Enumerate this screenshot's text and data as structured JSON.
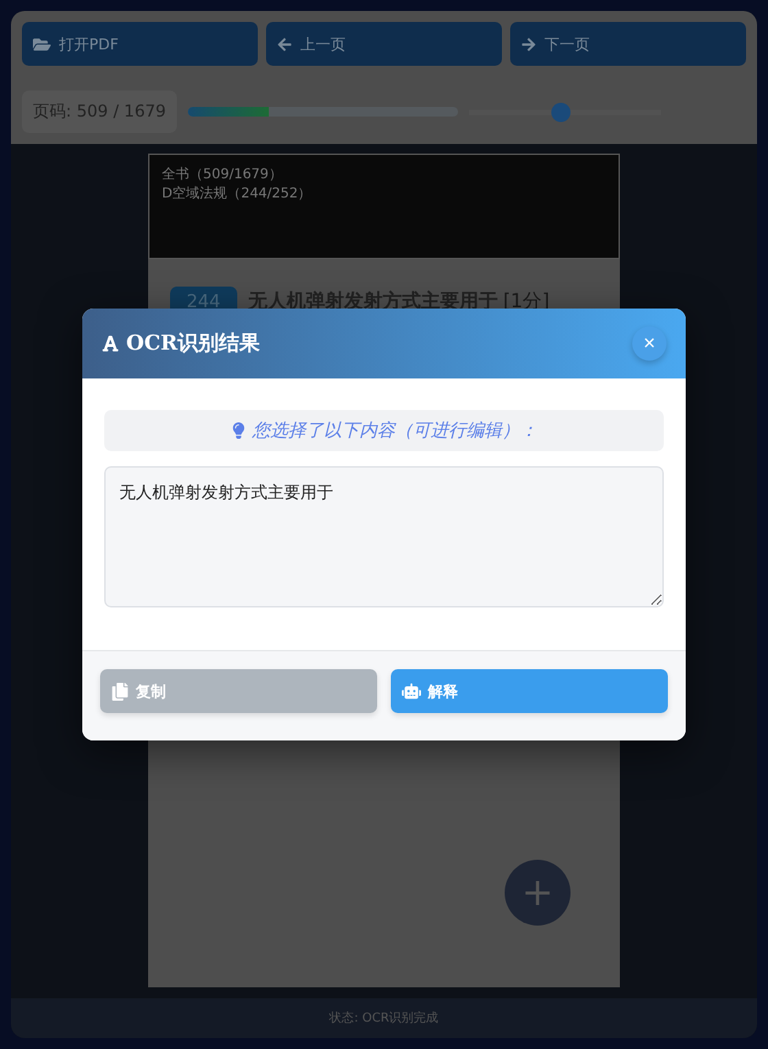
{
  "toolbar": {
    "buttons": [
      {
        "kind": "open",
        "label": "打开PDF"
      },
      {
        "kind": "prev",
        "label": "上一页"
      },
      {
        "kind": "next",
        "label": "下一页"
      }
    ]
  },
  "page_info": {
    "label": "页码: 509 / 1679",
    "progress": {
      "level": 0.3
    },
    "zoom_slider": {
      "level": 0.48
    }
  },
  "document": {
    "header_lines": [
      "全书（509/1679）",
      "D空域法规（244/252）"
    ],
    "question": {
      "number": "244",
      "title": "无人机弹射发射方式主要用于",
      "score": "[1分]"
    }
  },
  "fab": {
    "label": "+"
  },
  "status_bar": {
    "text": "状态: OCR识别完成"
  },
  "dialog": {
    "title": "OCR识别结果",
    "close": "×",
    "hint": "您选择了以下内容（可进行编辑）：",
    "text": "无人机弹射发射方式主要用于",
    "buttons": [
      {
        "kind": "secondary",
        "label": "复制"
      },
      {
        "kind": "primary",
        "label": "解释"
      }
    ]
  }
}
